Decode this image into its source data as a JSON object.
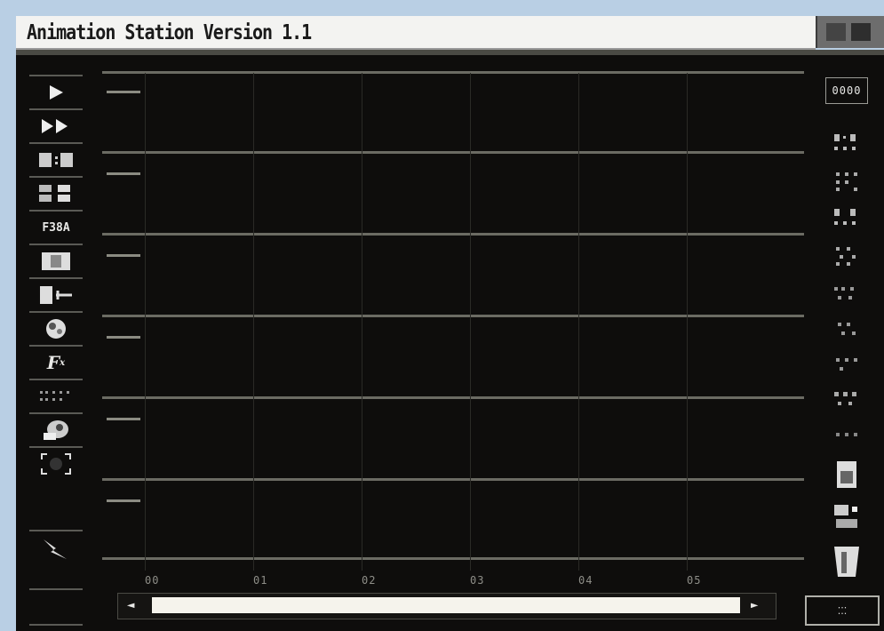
{
  "window": {
    "title": "Animation Station  Version  1.1"
  },
  "left_toolbar": [
    {
      "name": "play-icon"
    },
    {
      "name": "fast-forward-icon"
    },
    {
      "name": "frame-counter-icon"
    },
    {
      "name": "frames-icon"
    },
    {
      "name": "frame-label-icon",
      "label": "F38A"
    },
    {
      "name": "frame-view-icon"
    },
    {
      "name": "insert-frame-icon"
    },
    {
      "name": "palette-icon"
    },
    {
      "name": "effects-icon",
      "label": "F"
    },
    {
      "name": "dotted-grid-icon"
    },
    {
      "name": "paint-tool-icon"
    },
    {
      "name": "select-area-icon"
    },
    {
      "name": "lightning-icon"
    }
  ],
  "right_toolbar": [
    {
      "name": "counter-display",
      "label": "0000"
    },
    {
      "name": "track-control-1-icon"
    },
    {
      "name": "track-control-2-icon"
    },
    {
      "name": "track-control-3-icon"
    },
    {
      "name": "track-control-4-icon"
    },
    {
      "name": "track-control-5-icon"
    },
    {
      "name": "track-control-6-icon"
    },
    {
      "name": "track-control-7-icon"
    },
    {
      "name": "track-control-8-icon"
    },
    {
      "name": "track-control-9-icon"
    },
    {
      "name": "document-icon"
    },
    {
      "name": "settings-icon"
    },
    {
      "name": "trash-icon"
    }
  ],
  "timeline": {
    "time_labels": [
      "00",
      "01",
      "02",
      "03",
      "04",
      "05"
    ],
    "tracks": 6
  },
  "scrollbar": {
    "left_arrow": "◄",
    "right_arrow": "►"
  },
  "bottom_button": {
    "label": "⁚⁚⁚"
  }
}
